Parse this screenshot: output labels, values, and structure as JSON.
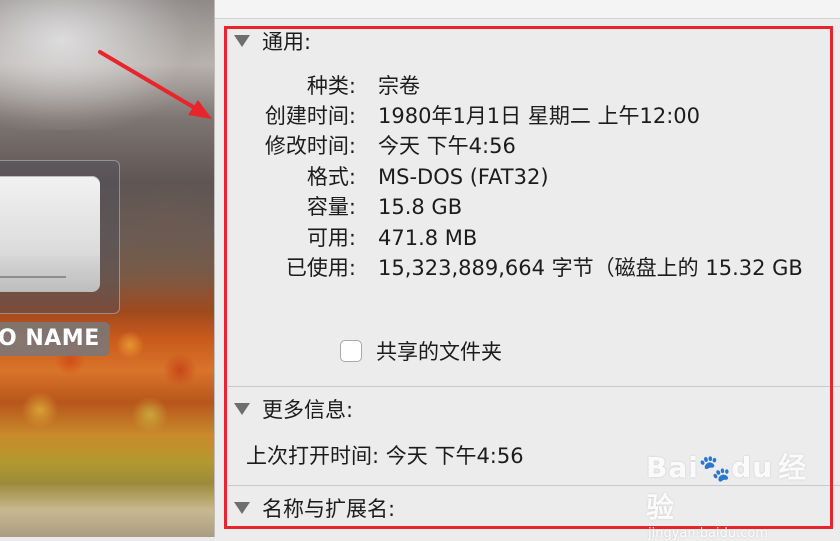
{
  "desktop": {
    "drive_label": "O NAME"
  },
  "general": {
    "header": "通用:",
    "rows": [
      {
        "label": "种类:",
        "value": "宗卷"
      },
      {
        "label": "创建时间:",
        "value": "1980年1月1日 星期二 上午12:00"
      },
      {
        "label": "修改时间:",
        "value": "今天 下午4:56"
      },
      {
        "label": "格式:",
        "value": "MS-DOS (FAT32)"
      },
      {
        "label": "容量:",
        "value": "15.8 GB"
      },
      {
        "label": "可用:",
        "value": "471.8 MB"
      },
      {
        "label": "已使用:",
        "value": "15,323,889,664 字节（磁盘上的 15.32 GB"
      }
    ],
    "shared_folder_label": "共享的文件夹"
  },
  "more_info": {
    "header": "更多信息:",
    "last_opened_label": "上次打开时间:",
    "last_opened_value": "今天 下午4:56"
  },
  "name_ext": {
    "header": "名称与扩展名:"
  },
  "watermark": {
    "brand": "Bai",
    "brand_tail": "du",
    "suffix": "经验",
    "url": "jingyan.baidu.com"
  },
  "colors": {
    "highlight": "#e8252a",
    "arrow": "#e8252a",
    "panel_bg": "#ececec"
  }
}
